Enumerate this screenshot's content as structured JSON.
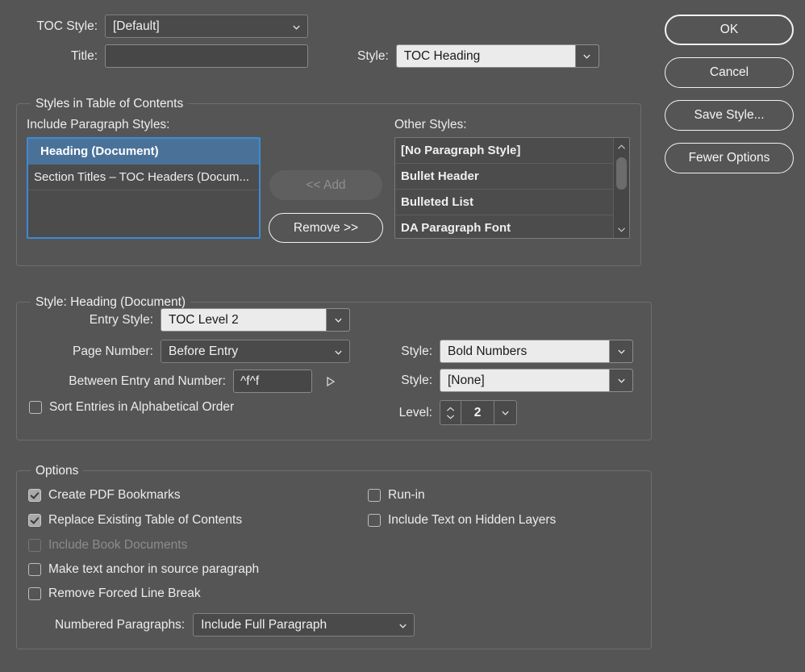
{
  "dialog": {
    "toc_style": {
      "label": "TOC Style:",
      "value": "[Default]"
    },
    "title": {
      "label": "Title:",
      "value": "",
      "placeholder": ""
    },
    "title_style": {
      "label": "Style:",
      "value": "TOC Heading"
    }
  },
  "buttons": {
    "ok": "OK",
    "cancel": "Cancel",
    "save_style": "Save Style...",
    "fewer_options": "Fewer Options"
  },
  "styles_group": {
    "legend": "Styles in Table of Contents",
    "include_label": "Include Paragraph Styles:",
    "include_items": [
      {
        "label": "Heading (Document)",
        "selected": true
      },
      {
        "label": "Section Titles – TOC Headers (Docum...",
        "selected": false
      }
    ],
    "other_label": "Other Styles:",
    "other_items": [
      "[No Paragraph Style]",
      "Bullet Header",
      "Bulleted List",
      "DA Paragraph Font"
    ],
    "add_button": "<< Add",
    "remove_button": "Remove >>"
  },
  "style_detail": {
    "legend": "Style: Heading (Document)",
    "entry_style": {
      "label": "Entry Style:",
      "value": "TOC Level 2"
    },
    "page_number": {
      "label": "Page Number:",
      "value": "Before Entry"
    },
    "page_number_style": {
      "label": "Style:",
      "value": "Bold Numbers"
    },
    "between": {
      "label": "Between Entry and Number:",
      "value": "^f^f"
    },
    "between_style": {
      "label": "Style:",
      "value": "[None]"
    },
    "sort_entries": {
      "label": "Sort Entries in Alphabetical Order",
      "checked": false
    },
    "level": {
      "label": "Level:",
      "value": "2"
    }
  },
  "options_group": {
    "legend": "Options",
    "items": [
      {
        "label": "Create PDF Bookmarks",
        "checked": true,
        "disabled": false
      },
      {
        "label": "Replace Existing Table of Contents",
        "checked": true,
        "disabled": false
      },
      {
        "label": "Include Book Documents",
        "checked": false,
        "disabled": true
      },
      {
        "label": "Make text anchor in source paragraph",
        "checked": false,
        "disabled": false
      },
      {
        "label": "Remove Forced Line Break",
        "checked": false,
        "disabled": false
      },
      {
        "label": "Run-in",
        "checked": false,
        "disabled": false
      },
      {
        "label": "Include Text on Hidden Layers",
        "checked": false,
        "disabled": false
      }
    ],
    "numbered_paragraphs": {
      "label": "Numbered Paragraphs:",
      "value": "Include Full Paragraph"
    }
  },
  "colors": {
    "background": "#555555",
    "selection_blue": "#4a7299",
    "focus_border": "#3e8ad6",
    "field_dark": "#4a4a4a",
    "field_light": "#ebebeb"
  }
}
